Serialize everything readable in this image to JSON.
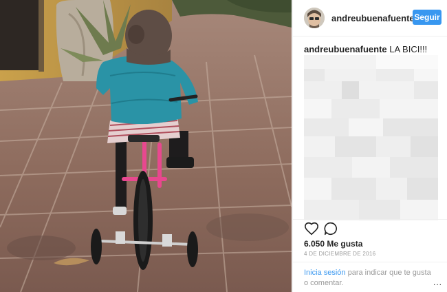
{
  "post": {
    "photo_alt": "",
    "header": {
      "username": "andreubuenafuente",
      "follow_label": "Seguir"
    },
    "caption": {
      "username": "andreubuenafuente",
      "text": "LA BICI!!!"
    },
    "likes": "6.050 Me gusta",
    "date": "4 DE DICIEMBRE DE 2016",
    "footer": {
      "login_link": "Inicia sesión",
      "login_text": "para indicar que te gusta o comentar."
    },
    "more_label": "..."
  },
  "colors": {
    "accent": "#3897f0",
    "text": "#262626",
    "muted": "#999999",
    "divider": "#efefef"
  },
  "icons": [
    "heart-icon",
    "comment-icon",
    "more-options-icon"
  ]
}
